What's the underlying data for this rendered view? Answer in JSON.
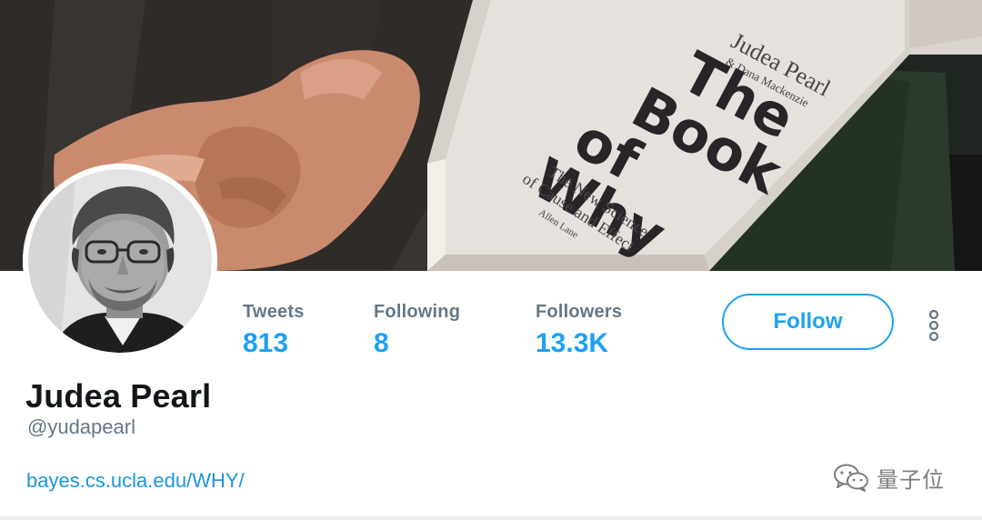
{
  "banner": {
    "book_author": "Judea Pearl",
    "book_coauthor": "& Dana Mackenzie",
    "book_title_lines": [
      "The",
      "Book",
      "of",
      "Why"
    ],
    "book_subtitle_lines": [
      "The New Science",
      "of Cause and Effect"
    ],
    "book_edition": "Allen Lane"
  },
  "stats": {
    "tweets_label": "Tweets",
    "tweets_value": "813",
    "following_label": "Following",
    "following_value": "8",
    "followers_label": "Followers",
    "followers_value": "13.3K"
  },
  "actions": {
    "follow_label": "Follow",
    "more_icon": "more-vertical-icon"
  },
  "profile": {
    "name": "Judea Pearl",
    "handle": "@yudapearl",
    "website": "bayes.cs.ucla.edu/WHY/"
  },
  "watermark": {
    "icon": "wechat-icon",
    "text": "量子位"
  },
  "colors": {
    "accent": "#1da1f2",
    "link": "#1b95e0",
    "muted": "#657786",
    "text": "#14171a"
  }
}
